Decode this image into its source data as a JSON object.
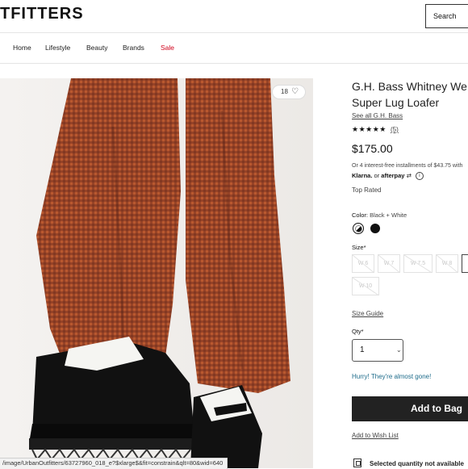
{
  "header": {
    "logo": "TFITTERS",
    "search_placeholder": "Search"
  },
  "nav": {
    "items": [
      "Home",
      "Lifestyle",
      "Beauty",
      "Brands",
      "Sale"
    ]
  },
  "product_image": {
    "likes": "18",
    "status_url": "/image/UrbanOutfitters/63727960_018_e?$xlarge$&fit=constrain&qlt=80&wid=640"
  },
  "product": {
    "title_line1": "G.H. Bass Whitney We",
    "title_line2": "Super Lug Loafer",
    "brand_link": "See all G.H. Bass",
    "stars": "★★★★★",
    "review_count": "(5)",
    "rating": 5,
    "price": "$175.00",
    "installments": "Or 4 interest-free installments of $43.75 with",
    "klarna": "Klarna.",
    "or": "or",
    "afterpay": "afterpay",
    "top_rated": "Top Rated",
    "color_label": "Color:",
    "color_value": "Black + White",
    "size_label": "Size*",
    "sizes": [
      {
        "label": "W 6",
        "available": false
      },
      {
        "label": "W 7",
        "available": false
      },
      {
        "label": "W 7.5",
        "available": false
      },
      {
        "label": "W 8",
        "available": false
      },
      {
        "label": "",
        "available": true,
        "selected": true
      },
      {
        "label": "W 10",
        "available": false
      }
    ],
    "size_guide": "Size Guide",
    "qty_label": "Qty*",
    "qty_value": "1",
    "hurry": "Hurry! They're almost gone!",
    "add_to_bag": "Add to Bag",
    "wish_list": "Add to Wish List",
    "shipping_text": "Selected quantity not available"
  },
  "colors": {
    "sale": "#d0021b",
    "button_bg": "#222222",
    "hurry": "#1d6b8a",
    "pants": "#b2532f"
  }
}
